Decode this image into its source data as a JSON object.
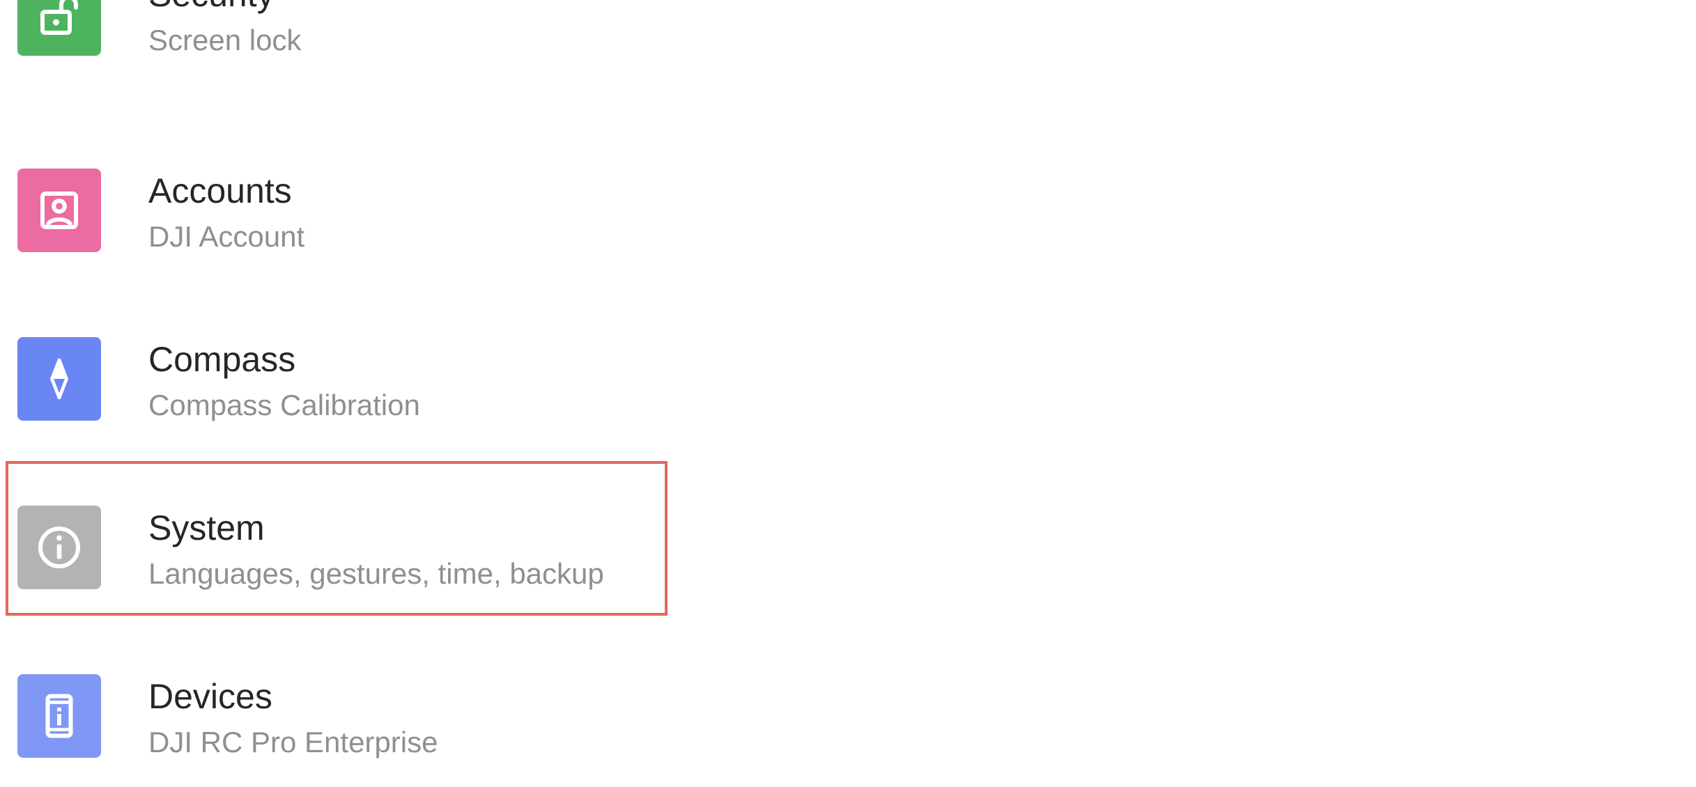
{
  "settings": {
    "items": [
      {
        "id": "security",
        "title": "Security",
        "subtitle": "Screen lock",
        "icon": "unlocked-padlock-icon",
        "color": "#4db35f"
      },
      {
        "id": "accounts",
        "title": "Accounts",
        "subtitle": "DJI Account",
        "icon": "account-icon",
        "color": "#ec6ba0"
      },
      {
        "id": "compass",
        "title": "Compass",
        "subtitle": "Compass Calibration",
        "icon": "compass-icon",
        "color": "#6a86f5"
      },
      {
        "id": "system",
        "title": "System",
        "subtitle": "Languages, gestures, time, backup",
        "icon": "info-icon",
        "color": "#b3b3b3"
      },
      {
        "id": "devices",
        "title": "Devices",
        "subtitle": "DJI RC Pro Enterprise",
        "icon": "device-icon",
        "color": "#7f98f5"
      }
    ]
  },
  "highlight": {
    "item": "system",
    "color": "#e2675c"
  }
}
